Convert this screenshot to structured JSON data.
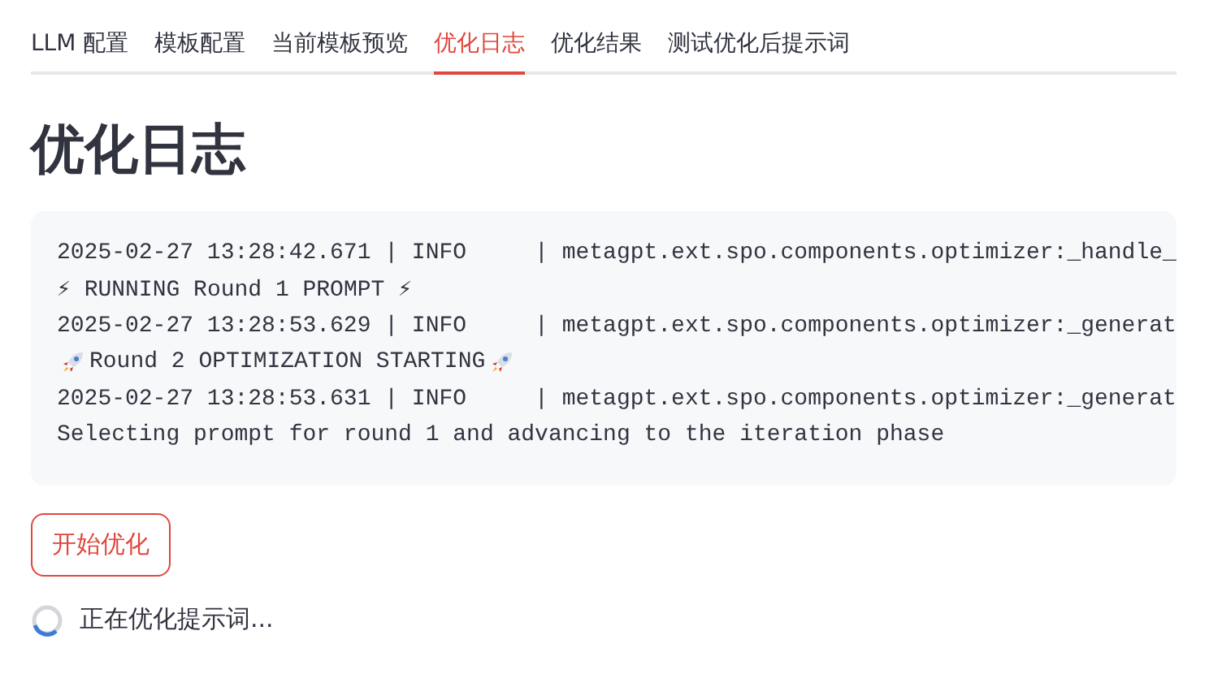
{
  "tabs": [
    {
      "label": "LLM 配置",
      "selected": false
    },
    {
      "label": "模板配置",
      "selected": false
    },
    {
      "label": "当前模板预览",
      "selected": false
    },
    {
      "label": "优化日志",
      "selected": true
    },
    {
      "label": "优化结果",
      "selected": false
    },
    {
      "label": "测试优化后提示词",
      "selected": false
    }
  ],
  "heading": "优化日志",
  "log_lines": [
    {
      "kind": "plain",
      "text": "2025-02-27 13:28:42.671 | INFO     | metagpt.ext.spo.components.optimizer:_handle_"
    },
    {
      "kind": "plain",
      "text": "⚡ RUNNING Round 1 PROMPT ⚡"
    },
    {
      "kind": "plain",
      "text": "2025-02-27 13:28:53.629 | INFO     | metagpt.ext.spo.components.optimizer:_generat"
    },
    {
      "kind": "rocket_banner",
      "text": "Round 2 OPTIMIZATION STARTING"
    },
    {
      "kind": "plain",
      "text": "2025-02-27 13:28:53.631 | INFO     | metagpt.ext.spo.components.optimizer:_generat"
    },
    {
      "kind": "plain",
      "text": "Selecting prompt for round 1 and advancing to the iteration phase"
    }
  ],
  "start_button": "开始优化",
  "status": {
    "text": "正在优化提示词...",
    "loading": true
  }
}
